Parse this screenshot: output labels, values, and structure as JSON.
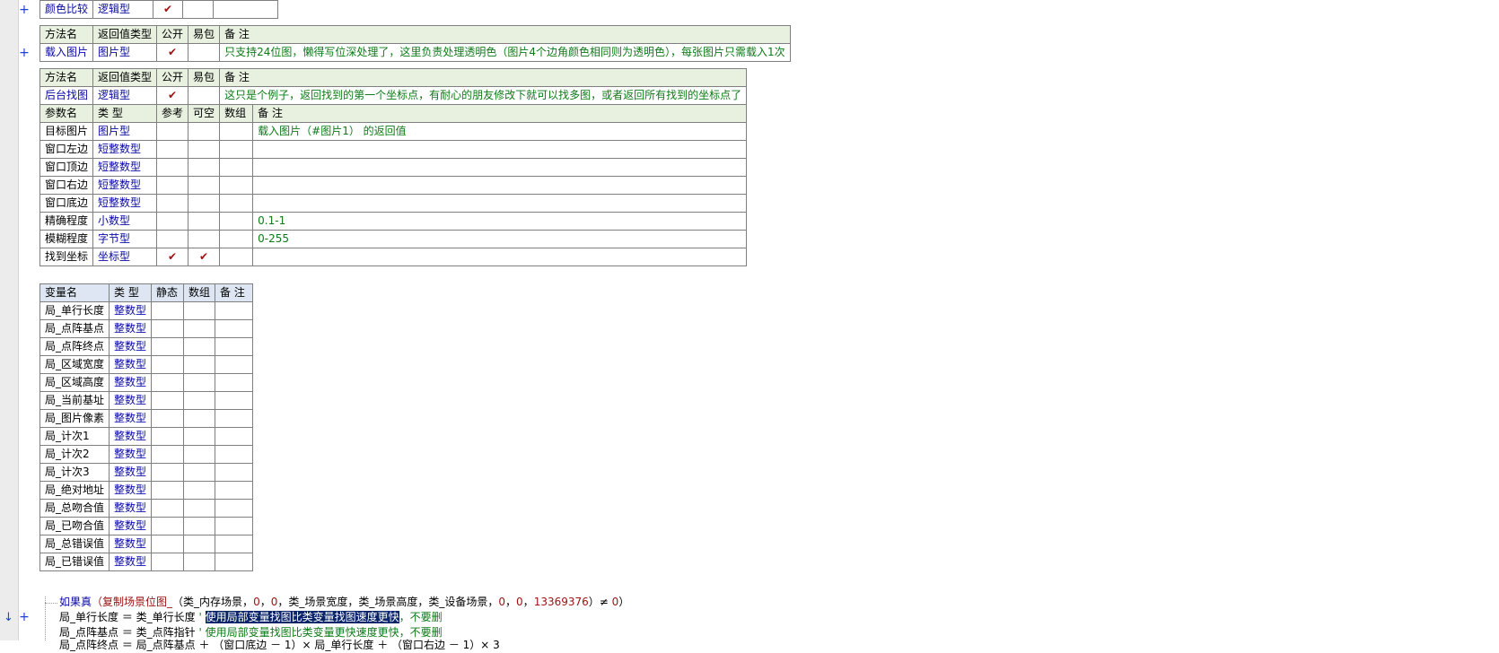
{
  "toolbar_marks": {
    "plus": "+",
    "arrow": "↓"
  },
  "colors": {
    "type_link": "#0a0aa5",
    "comment": "#0d7a17",
    "check": "#a11212",
    "header_bg": "#e8f0e0",
    "var_header_bg": "#dde6f2"
  },
  "check_glyph": "✔",
  "t1": {
    "name": "颜色比较",
    "type": "逻辑型"
  },
  "t2": {
    "headers": [
      "方法名",
      "返回值类型",
      "公开",
      "易包",
      "备 注"
    ],
    "name": "载入图片",
    "type": "图片型",
    "remark": "只支持24位图，懒得写位深处理了，这里负责处理透明色（图片4个边角颜色相同则为透明色），每张图片只需载入1次"
  },
  "t3": {
    "headers": [
      "方法名",
      "返回值类型",
      "公开",
      "易包",
      "备 注"
    ],
    "name": "后台找图",
    "type": "逻辑型",
    "remark": "这只是个例子，返回找到的第一个坐标点，有耐心的朋友修改下就可以找多图，或者返回所有找到的坐标点了",
    "param_headers": [
      "参数名",
      "类 型",
      "参考",
      "可空",
      "数组",
      "备 注"
    ],
    "params": [
      {
        "name": "目标图片",
        "type": "图片型",
        "remark": "载入图片（#图片1） 的返回值"
      },
      {
        "name": "窗口左边",
        "type": "短整数型",
        "remark": ""
      },
      {
        "name": "窗口顶边",
        "type": "短整数型",
        "remark": ""
      },
      {
        "name": "窗口右边",
        "type": "短整数型",
        "remark": ""
      },
      {
        "name": "窗口底边",
        "type": "短整数型",
        "remark": ""
      },
      {
        "name": "精确程度",
        "type": "小数型",
        "remark": "0.1-1"
      },
      {
        "name": "模糊程度",
        "type": "字节型",
        "remark": "0-255"
      },
      {
        "name": "找到坐标",
        "type": "坐标型",
        "remark": ""
      }
    ]
  },
  "vars": {
    "headers": [
      "变量名",
      "类 型",
      "静态",
      "数组",
      "备 注"
    ],
    "rows": [
      {
        "name": "局_单行长度",
        "type": "整数型"
      },
      {
        "name": "局_点阵基点",
        "type": "整数型"
      },
      {
        "name": "局_点阵终点",
        "type": "整数型"
      },
      {
        "name": "局_区域宽度",
        "type": "整数型"
      },
      {
        "name": "局_区域高度",
        "type": "整数型"
      },
      {
        "name": "局_当前基址",
        "type": "整数型"
      },
      {
        "name": "局_图片像素",
        "type": "整数型"
      },
      {
        "name": "局_计次1",
        "type": "整数型"
      },
      {
        "name": "局_计次2",
        "type": "整数型"
      },
      {
        "name": "局_计次3",
        "type": "整数型"
      },
      {
        "name": "局_绝对地址",
        "type": "整数型"
      },
      {
        "name": "局_总吻合值",
        "type": "整数型"
      },
      {
        "name": "局_已吻合值",
        "type": "整数型"
      },
      {
        "name": "局_总错误值",
        "type": "整数型"
      },
      {
        "name": "局_已错误值",
        "type": "整数型"
      }
    ]
  },
  "code": {
    "line1": {
      "kw": "如果真",
      "paren_open": "（",
      "fn": "复制场景位图_",
      "args_a": "（类_内存场景，",
      "n1": "0",
      "c1": "，",
      "n2": "0",
      "args_b": "，类_场景宽度，类_场景高度，类_设备场景，",
      "n3": "0",
      "c2": "，",
      "n4": "0",
      "c3": "，",
      "n5": "13369376",
      "close": "）≠ ",
      "n6": "0",
      "end": "）"
    },
    "line2": {
      "code": "局_单行长度 ＝ 类_单行长度  ",
      "q": "' ",
      "sel": "使用局部变量找图比类变量找图速度更快",
      "rest": "，不要删"
    },
    "line3": {
      "code": "局_点阵基点 ＝ 类_点阵指针  ",
      "comment": "' 使用局部变量找图比类变量更快速度更快，不要删"
    },
    "line4": {
      "code": "局_点阵终点 ＝ 局_点阵基点 ＋ （窗口底边 － 1）× 局_单行长度 ＋ （窗口右边 － 1）× 3"
    }
  }
}
